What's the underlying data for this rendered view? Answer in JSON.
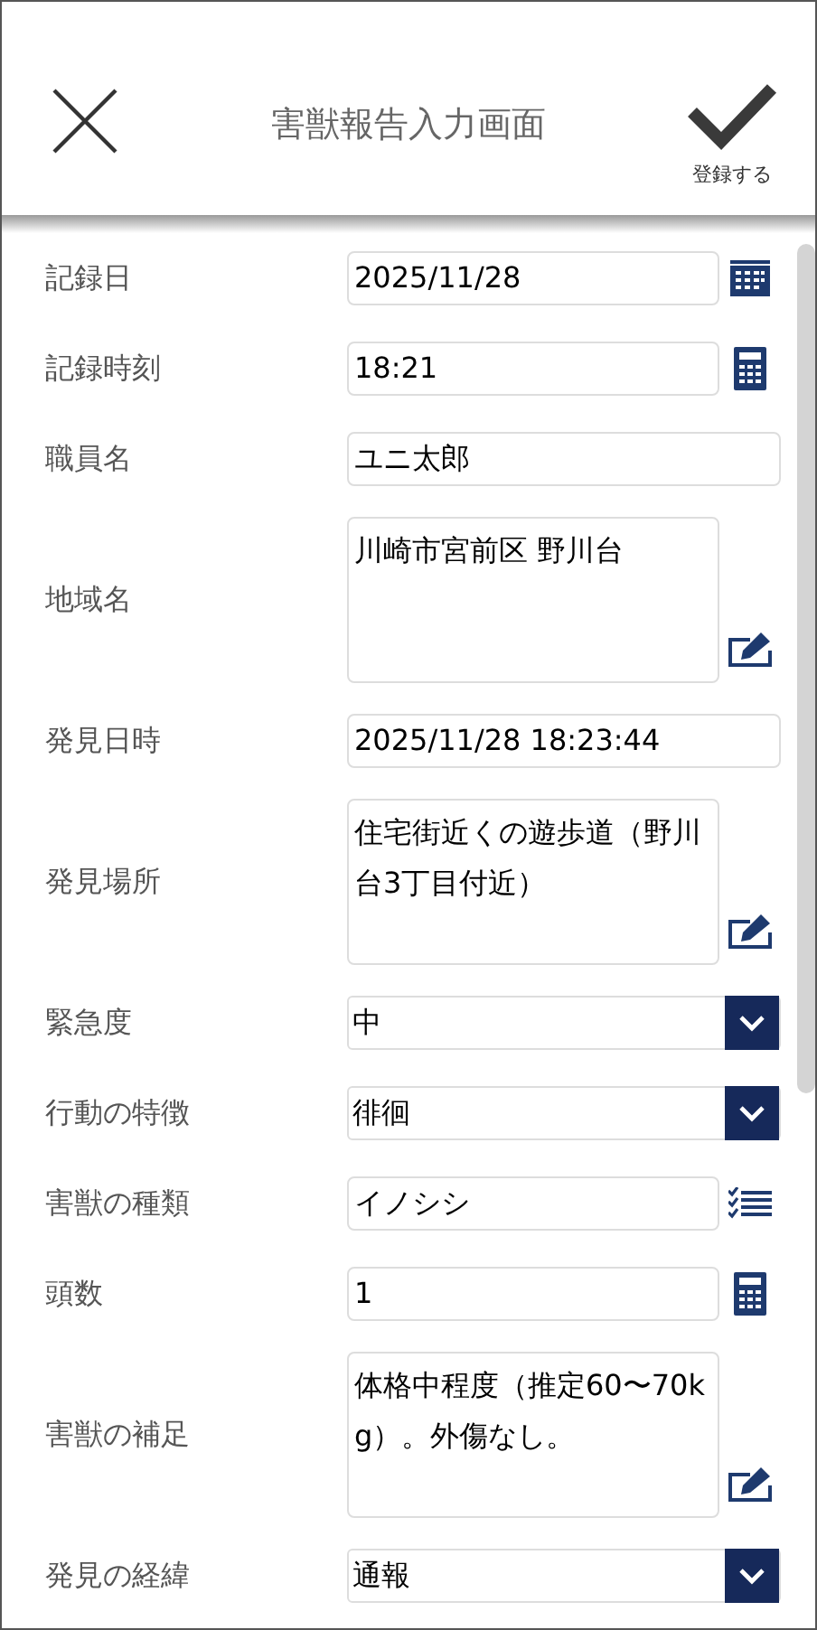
{
  "header": {
    "title": "害獣報告入力画面",
    "save_label": "登録する"
  },
  "fields": [
    {
      "label": "記録日",
      "value": "2025/11/28",
      "kind": "date"
    },
    {
      "label": "記録時刻",
      "value": "18:21",
      "kind": "number"
    },
    {
      "label": "職員名",
      "value": "ユニ太郎",
      "kind": "text"
    },
    {
      "label": "地域名",
      "value": "川崎市宮前区 野川台",
      "kind": "note"
    },
    {
      "label": "発見日時",
      "value": "2025/11/28 18:23:44",
      "kind": "text"
    },
    {
      "label": "発見場所",
      "value": "住宅街近くの遊歩道（野川台3丁目付近）",
      "kind": "note"
    },
    {
      "label": "緊急度",
      "value": "中",
      "kind": "select"
    },
    {
      "label": "行動の特徴",
      "value": "徘徊",
      "kind": "select"
    },
    {
      "label": "害獣の種類",
      "value": "イノシシ",
      "kind": "choice"
    },
    {
      "label": "頭数",
      "value": "1",
      "kind": "number"
    },
    {
      "label": "害獣の補足",
      "value": "体格中程度（推定60〜70kg）。外傷なし。",
      "kind": "note"
    },
    {
      "label": "発見の経緯",
      "value": "通報",
      "kind": "select"
    }
  ]
}
